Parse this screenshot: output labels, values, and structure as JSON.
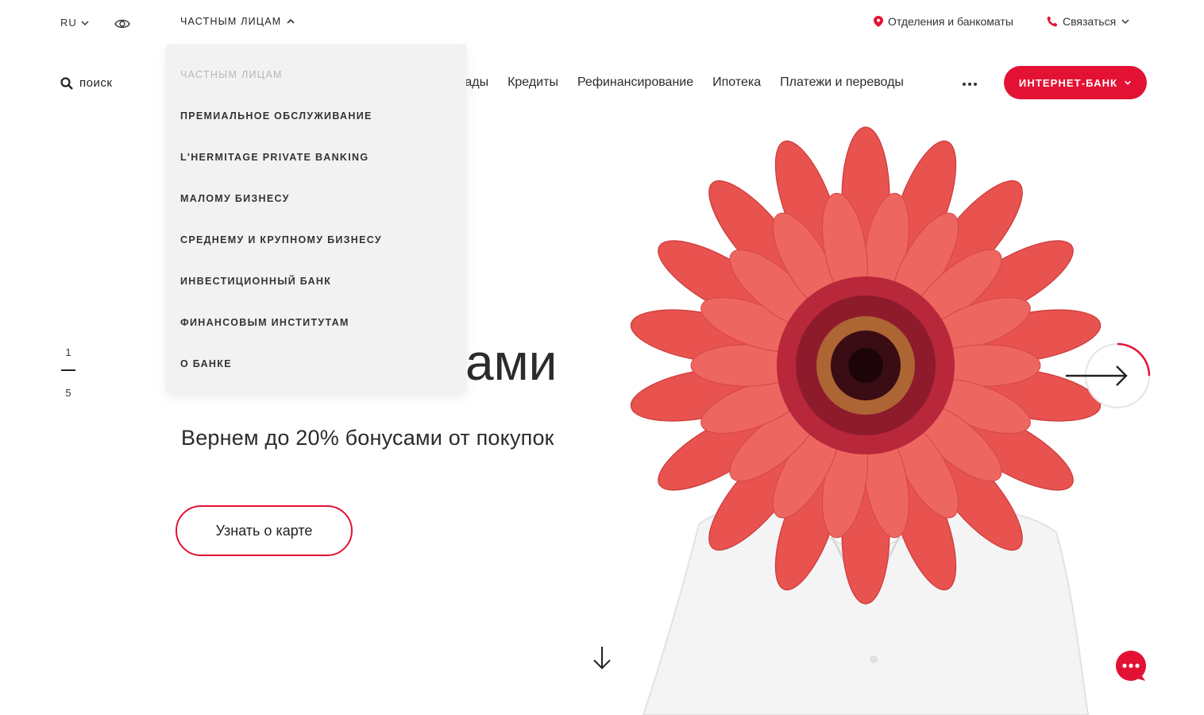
{
  "topbar": {
    "lang": "RU",
    "segment": "ЧАСТНЫМ ЛИЦАМ",
    "branches": "Отделения и банкоматы",
    "contact": "Связаться"
  },
  "nav": {
    "search": "поиск",
    "links": [
      "Вклады",
      "Кредиты",
      "Рефинансирование",
      "Ипотека",
      "Платежи и переводы"
    ],
    "partial_link": "лады",
    "internet_bank": "ИНТЕРНЕТ-БАНК"
  },
  "dropdown": {
    "items": [
      "ЧАСТНЫМ ЛИЦАМ",
      "ПРЕМИАЛЬНОЕ ОБСЛУЖИВАНИЕ",
      "L'HERMITAGE PRIVATE BANKING",
      "МАЛОМУ БИЗНЕСУ",
      "СРЕДНЕМУ И КРУПНОМУ БИЗНЕСУ",
      "ИНВЕСТИЦИОННЫЙ БАНК",
      "ФИНАНСОВЫМ ИНСТИТУТАМ",
      "О БАНКЕ"
    ]
  },
  "slider": {
    "current": "1",
    "total": "5"
  },
  "hero": {
    "title_visible": "ами",
    "subtitle": "Вернем до 20% бонусами от покупок",
    "cta": "Узнать о карте"
  },
  "colors": {
    "accent": "#e31235",
    "dropdown_bg": "#f2f2f2",
    "flower": "#e8524f"
  },
  "icons": {
    "eye": "eye-icon",
    "pin": "location-pin-icon",
    "phone": "phone-icon",
    "search": "search-icon",
    "next": "arrow-right-icon",
    "scroll": "arrow-down-icon",
    "chat": "chat-icon"
  }
}
